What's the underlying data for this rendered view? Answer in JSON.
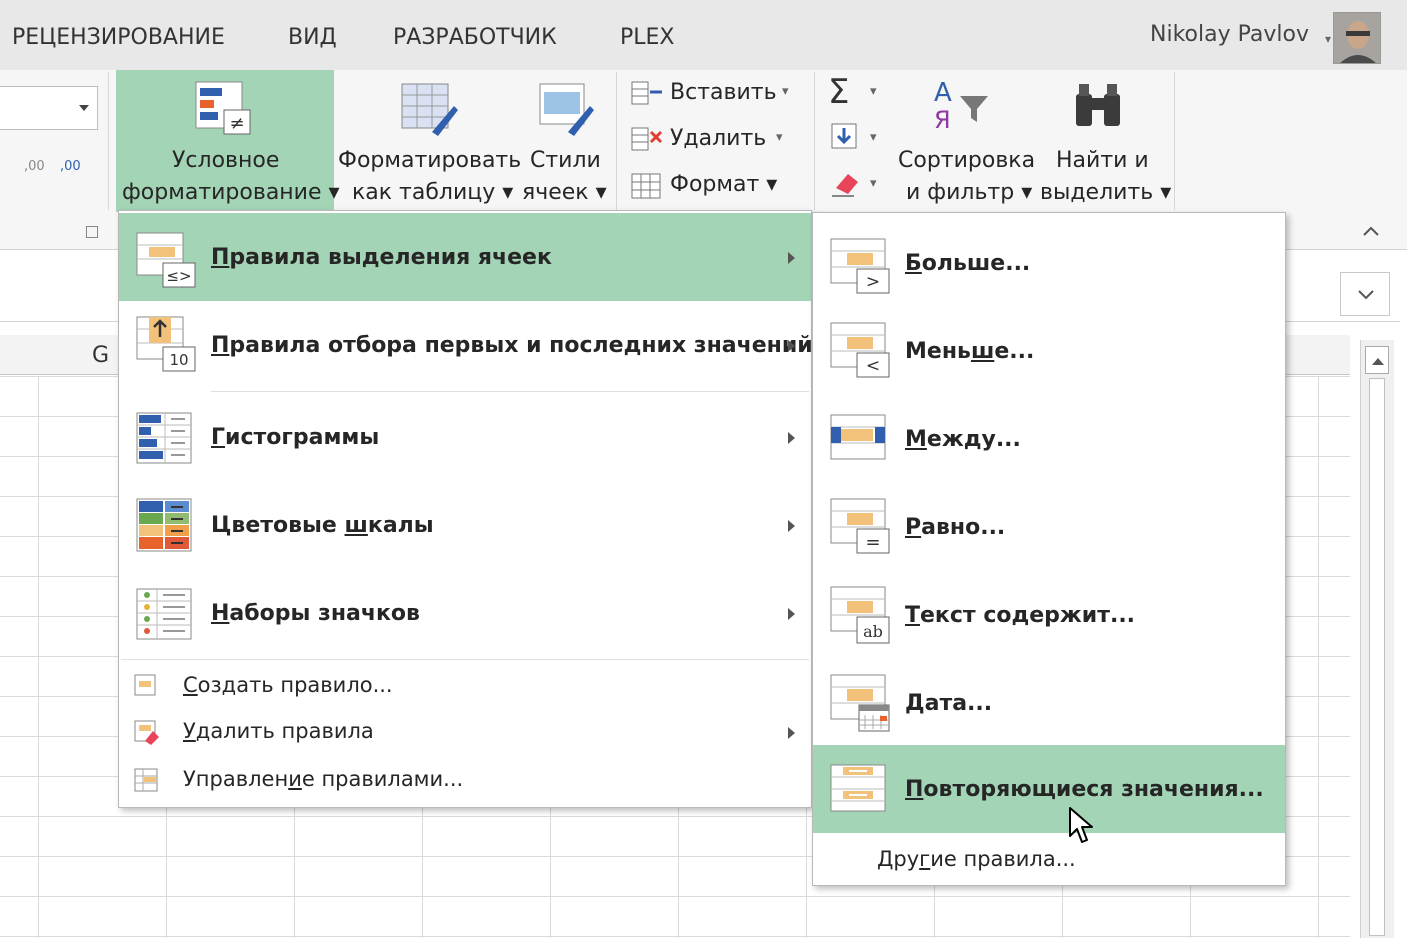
{
  "tabs": [
    "РЕЦЕНЗИРОВАНИЕ",
    "ВИД",
    "РАЗРАБОТЧИК",
    "PLEX"
  ],
  "user": {
    "name": "Nikolay Pavlov",
    "caret": "▾"
  },
  "ribbon": {
    "cond_format": {
      "line1": "Условное",
      "line2": "форматирование ▾"
    },
    "format_table": {
      "line1": "Форматировать",
      "line2": "как таблицу ▾"
    },
    "cell_styles": {
      "line1": "Стили",
      "line2": "ячеек ▾"
    },
    "insert": "Вставить",
    "delete": "Удалить",
    "format": "Формат ▾",
    "sort_filter": {
      "line1": "Сортировка",
      "line2": "и фильтр ▾"
    },
    "find_select": {
      "line1": "Найти и",
      "line2": "выделить ▾"
    },
    "caret": "▾",
    "collapse": "⌃",
    "sigma": "Σ",
    "dec_increase": ",00",
    "dec_decrease": ",00",
    "sort_az_top": "А",
    "sort_az_bottom": "Я"
  },
  "sheet": {
    "column_letter": "G"
  },
  "menu_main": {
    "items": [
      {
        "pre": "",
        "ul": "П",
        "post": "равила выделения ячеек",
        "icon_tag": "≤>"
      },
      {
        "pre": "",
        "ul": "П",
        "post": "равила отбора первых и последних значений",
        "icon_tag": "10"
      },
      {
        "pre": "",
        "ul": "Г",
        "post": "истограммы"
      },
      {
        "pre": "Цветовые ",
        "ul": "ш",
        "post": "калы"
      },
      {
        "pre": "",
        "ul": "Н",
        "post": "аборы значков"
      }
    ],
    "actions": [
      {
        "pre": "",
        "ul": "С",
        "post": "оздать правило..."
      },
      {
        "pre": "",
        "ul": "У",
        "post": "далить правила"
      },
      {
        "pre": "Управлен",
        "ul": "и",
        "post": "е правилами..."
      }
    ]
  },
  "menu_sub": {
    "items": [
      {
        "pre": "",
        "ul": "Б",
        "post": "ольше...",
        "icon_tag": ">"
      },
      {
        "pre": "Мень",
        "ul": "ш",
        "post": "е...",
        "icon_tag": "<"
      },
      {
        "pre": "",
        "ul": "М",
        "post": "ежду..."
      },
      {
        "pre": "",
        "ul": "Р",
        "post": "авно...",
        "icon_tag": "="
      },
      {
        "pre": "",
        "ul": "Т",
        "post": "екст содержит...",
        "icon_tag": "ab"
      },
      {
        "pre": "",
        "ul": "Д",
        "post": "ата..."
      },
      {
        "pre": "",
        "ul": "П",
        "post": "овторяющиеся значения..."
      }
    ],
    "other": {
      "pre": "Дру",
      "ul": "г",
      "post": "ие правила..."
    }
  },
  "colors": {
    "accent_green": "#a3d4b5",
    "bar_orange": "#f2c27a",
    "bar_blue": "#2f5fad"
  }
}
